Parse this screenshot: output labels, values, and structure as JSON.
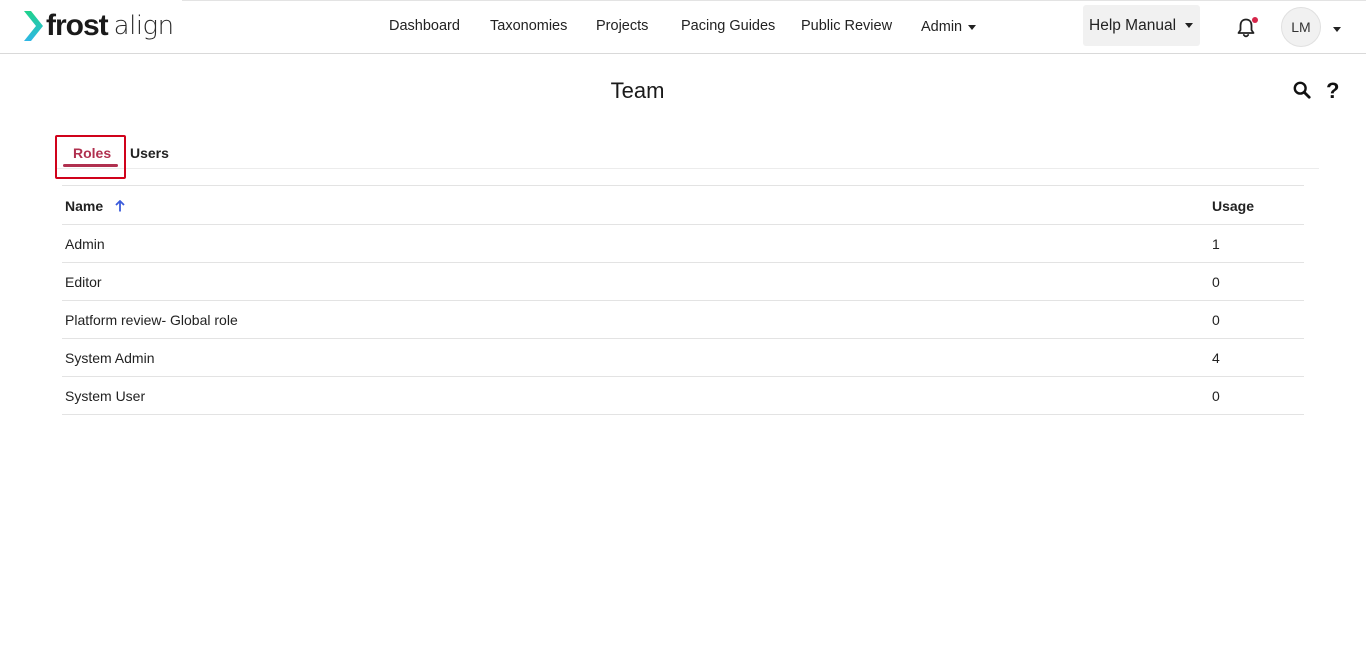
{
  "app": {
    "logo_bold": "frost",
    "logo_light": "align",
    "brand_colors": {
      "chevron_top": "#1fd28c",
      "chevron_bottom": "#2fb7e6",
      "accent": "#b0304f",
      "highlight_frame": "#d0021b"
    }
  },
  "nav": {
    "items": [
      "Dashboard",
      "Taxonomies",
      "Projects",
      "Pacing Guides",
      "Public Review",
      "Admin"
    ]
  },
  "header": {
    "help_manual": "Help Manual",
    "avatar_initials": "LM",
    "notification_icon": "bell-icon"
  },
  "page": {
    "title": "Team",
    "tabs": [
      {
        "label": "Roles",
        "active": true
      },
      {
        "label": "Users",
        "active": false
      }
    ]
  },
  "table": {
    "columns": {
      "name": "Name",
      "usage": "Usage"
    },
    "sort": {
      "column": "Name",
      "direction": "ascending"
    },
    "rows": [
      {
        "name": "Admin",
        "usage": "1"
      },
      {
        "name": "Editor",
        "usage": "0"
      },
      {
        "name": "Platform review- Global role",
        "usage": "0"
      },
      {
        "name": "System Admin",
        "usage": "4"
      },
      {
        "name": "System User",
        "usage": "0"
      }
    ]
  }
}
